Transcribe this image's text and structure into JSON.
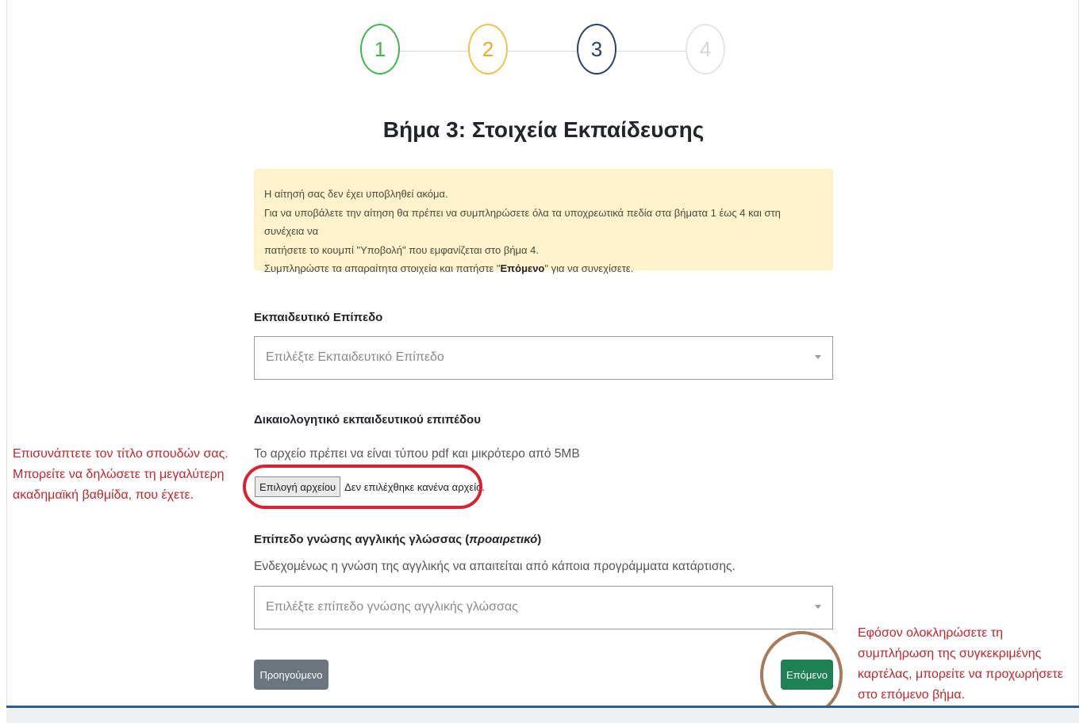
{
  "stepper": {
    "steps": [
      "1",
      "2",
      "3",
      "4"
    ],
    "active": 3,
    "colors": {
      "done1": "#42b64a",
      "done2": "#f0a820",
      "current": "#2c3e6b",
      "upcoming": "#d6d6d6"
    }
  },
  "page_title": "Βήμα 3: Στοιχεία Εκπαίδευσης",
  "alert": {
    "line1": "Η αίτησή σας δεν έχει υποβληθεί ακόμα.",
    "line2": "Για να υποβάλετε την αίτηση θα πρέπει να συμπληρώσετε όλα τα υποχρεωτικά πεδία στα βήματα 1 έως 4 και στη συνέχεια να",
    "line3": "πατήσετε το κουμπί \"Υποβολή\" που εμφανίζεται στο βήμα 4.",
    "line4_pre": "Συμπληρώστε τα απαραίτητα στοιχεία και πατήστε \"",
    "line4_bold": "Επόμενο",
    "line4_post": "\" για να συνεχίσετε."
  },
  "education_level": {
    "label": "Εκπαιδευτικό Επίπεδο",
    "placeholder": "Επιλέξτε Εκπαιδευτικό Επίπεδο"
  },
  "document": {
    "label": "Δικαιολογητικό εκπαιδευτικού επιπέδου",
    "hint": "Το αρχείο πρέπει να είναι τύπου pdf και μικρότερο από 5MB",
    "button": "Επιλογή αρχείου",
    "status": "Δεν επιλέχθηκε κανένα αρχείο."
  },
  "english": {
    "label_main": "Επίπεδο γνώσης αγγλικής γλώσσας (",
    "label_optional": "προαιρετικό",
    "label_close": ")",
    "hint": "Ενδεχομένως η γνώση της αγγλικής να απαιτείται από κάποια προγράμματα κατάρτισης.",
    "placeholder": "Επιλέξτε επίπεδο γνώσης αγγλικής γλώσσας"
  },
  "buttons": {
    "previous": "Προηγούμενο",
    "next": "Επόμενο"
  },
  "annotations": {
    "left": [
      "Επισυνάπτετε τον τίτλο σπουδών σας.",
      "Μπορείτε να δηλώσετε τη μεγαλύτερη",
      "ακαδημαϊκή βαθμίδα, που έχετε."
    ],
    "right": [
      "Εφόσον ολοκληρώσετε τη",
      "συμπλήρωση της συγκεκριμένης",
      "καρτέλας, μπορείτε να προχωρήσετε",
      "στο επόμενο βήμα."
    ],
    "color": "#c0272d"
  }
}
